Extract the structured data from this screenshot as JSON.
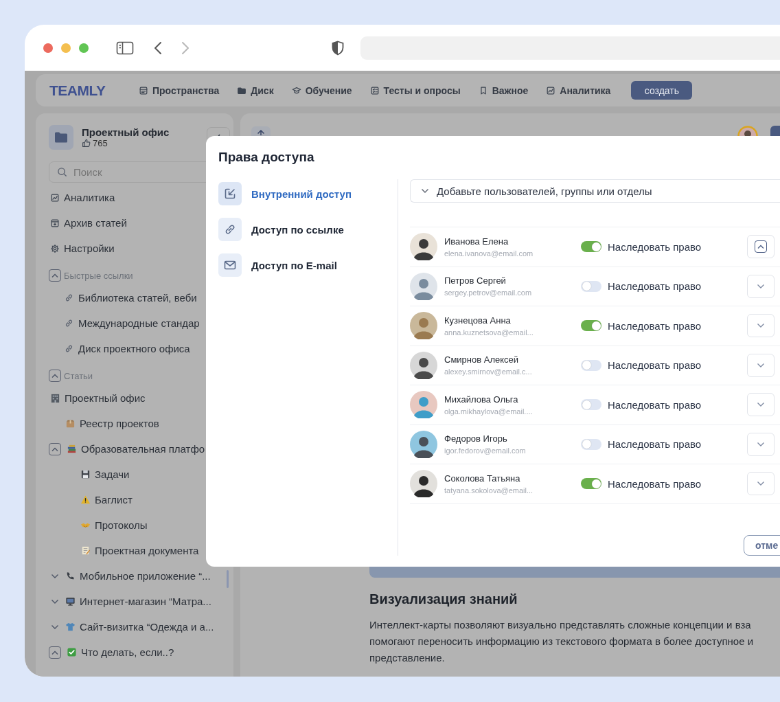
{
  "app": {
    "logo": "TEAMLY",
    "nav": [
      {
        "label": "Пространства"
      },
      {
        "label": "Диск"
      },
      {
        "label": "Обучение"
      },
      {
        "label": "Тесты и опросы"
      },
      {
        "label": "Важное"
      },
      {
        "label": "Аналитика"
      }
    ],
    "create_button": "создать"
  },
  "sidebar": {
    "title": "Проектный офис",
    "likes": "765",
    "search": {
      "placeholder": "Поиск"
    },
    "menu": [
      "Аналитика",
      "Архив статей",
      "Настройки"
    ],
    "quick_links": {
      "title": "Быстрые ссылки",
      "expanded": true,
      "items": [
        "Библиотека статей, веби",
        "Международные стандар",
        "Диск проектного офиса"
      ]
    },
    "articles": {
      "title": "Статьи",
      "expanded": true,
      "tree": [
        {
          "label": "Проектный офис",
          "children": [
            {
              "label": "Реестр проектов"
            },
            {
              "label": "Образовательная платфо",
              "expanded": true,
              "children": [
                {
                  "label": "Задачи"
                },
                {
                  "label": "Баглист"
                },
                {
                  "label": "Протоколы"
                },
                {
                  "label": "Проектная документа"
                }
              ]
            },
            {
              "label": "Мобильное приложение “...",
              "expanded": false
            },
            {
              "label": "Интернет-магазин “Матра...",
              "expanded": false
            },
            {
              "label": "Сайт-визитка “Одежда и а...",
              "expanded": false
            },
            {
              "label": "Что делать, если..?",
              "expanded": true
            }
          ]
        }
      ]
    }
  },
  "main": {
    "heading": "Визуализация знаний",
    "paragraph": "Интеллект-карты позволяют визуально представлять сложные концепции и вза\nпомогают переносить информацию из текстового формата в более доступное и\nпредставление."
  },
  "modal": {
    "title": "Права доступа",
    "tabs": [
      {
        "label": "Внутренний доступ",
        "selected": true
      },
      {
        "label": "Доступ по ссылке",
        "selected": false
      },
      {
        "label": "Доступ по E-mail",
        "selected": false
      }
    ],
    "add_field": {
      "placeholder": "Добавьте пользователей, группы или отделы"
    },
    "users": [
      {
        "name": "Иванова Елена",
        "email": "elena.ivanova@email.com",
        "inherit": true,
        "inherit_label": "Наследовать право",
        "expanded": true
      },
      {
        "name": "Петров Сергей",
        "email": "sergey.petrov@email.com",
        "inherit": false,
        "inherit_label": "Наследовать право",
        "expanded": false
      },
      {
        "name": "Кузнецова Анна",
        "email": "anna.kuznetsova@email...",
        "inherit": true,
        "inherit_label": "Наследовать право",
        "expanded": false
      },
      {
        "name": "Смирнов Алексей",
        "email": "alexey.smirnov@email.c...",
        "inherit": false,
        "inherit_label": "Наследовать право",
        "expanded": false
      },
      {
        "name": "Михайлова Ольга",
        "email": "olga.mikhaylova@email....",
        "inherit": false,
        "inherit_label": "Наследовать право",
        "expanded": false
      },
      {
        "name": "Федоров Игорь",
        "email": "igor.fedorov@email.com",
        "inherit": false,
        "inherit_label": "Наследовать право",
        "expanded": false
      },
      {
        "name": "Соколова Татьяна",
        "email": "tatyana.sokolova@email...",
        "inherit": true,
        "inherit_label": "Наследовать право",
        "expanded": false
      }
    ],
    "cancel_button": "отме"
  }
}
